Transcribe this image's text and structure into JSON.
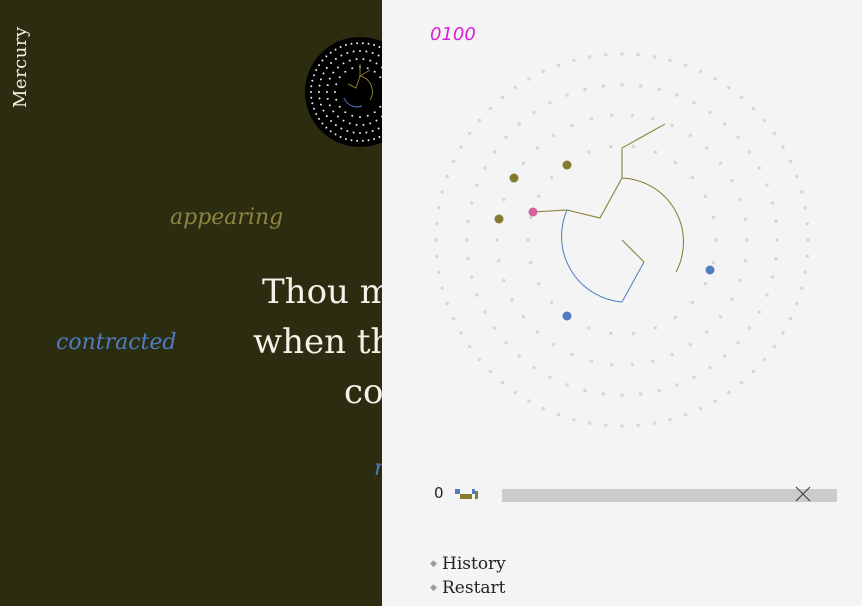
{
  "app": {
    "title": "Mercury"
  },
  "colors": {
    "background": "#2c2c10",
    "panel": "#f4f4f4",
    "olive": "#857a30",
    "blue": "#4f7cc2",
    "pink": "#d65f9e",
    "code": "#d61fd6"
  },
  "words": {
    "appearing": "appearing",
    "contracted": "contracted",
    "partial": "r"
  },
  "poem": {
    "line1": "Thou m",
    "line2": "when th",
    "line3": "co"
  },
  "panel": {
    "code": "0100",
    "progress_count": "0",
    "close_icon": "close-x-icon"
  },
  "menu": {
    "items": [
      {
        "label": "History",
        "icon": "diamond-icon"
      },
      {
        "label": "Restart",
        "icon": "diamond-icon"
      }
    ]
  }
}
